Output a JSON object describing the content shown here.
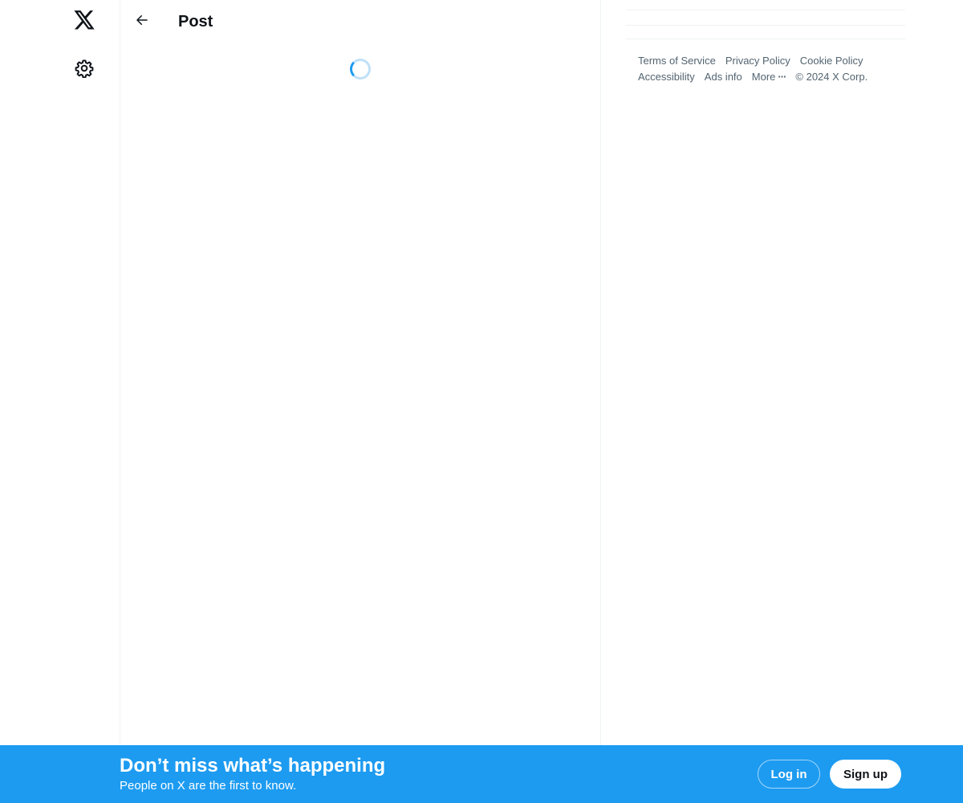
{
  "nav": {
    "logo_icon": "x-logo-icon",
    "settings_icon": "gear-icon"
  },
  "header": {
    "back_icon": "arrow-left-icon",
    "title": "Post"
  },
  "main": {
    "loading_indicator": "spinner",
    "spinner_color": "#1d9bf0"
  },
  "footer": {
    "terms": "Terms of Service",
    "privacy": "Privacy Policy",
    "cookie": "Cookie Policy",
    "accessibility": "Accessibility",
    "ads_info": "Ads info",
    "more": "More",
    "more_icon": "ellipsis-icon",
    "copyright": "© 2024 X Corp."
  },
  "banner": {
    "title": "Don’t miss what’s happening",
    "subtitle": "People on X are the first to know.",
    "login_label": "Log in",
    "signup_label": "Sign up",
    "background_color": "#1d9bf0"
  },
  "colors": {
    "accent": "#1d9bf0",
    "text_primary": "#0f1419",
    "text_secondary": "#536471",
    "border": "#eff3f4"
  }
}
